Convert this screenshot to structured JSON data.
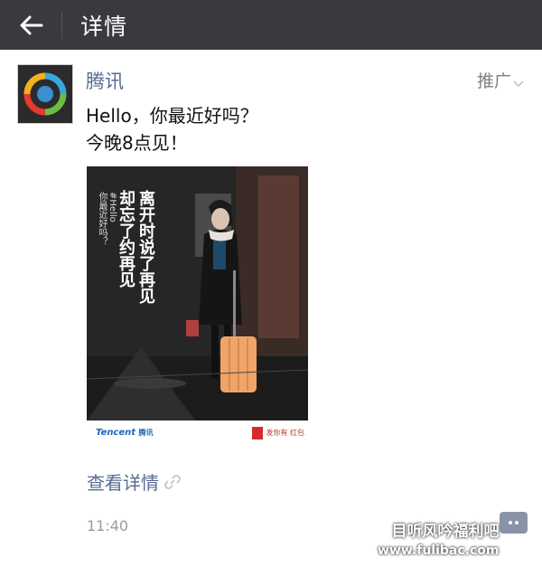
{
  "header": {
    "back_label": "←",
    "title": "详情"
  },
  "post": {
    "author": "腾讯",
    "promo_label": "推广",
    "text_lines": [
      "Hello，你最近好吗？",
      "今晚8点见！"
    ],
    "poster": {
      "calligraphy_lines": [
        "离开时说了再见",
        "却忘了约再见"
      ],
      "side_lines": [
        "#Hello",
        "你最近好吗？"
      ],
      "brand": "Tencent",
      "brand_cn": "腾讯",
      "redpack_text": "发你有 红包"
    },
    "link_label": "查看详情",
    "time": "11:40"
  },
  "watermark": {
    "line1": "目听风吟福利吧",
    "line2": "www.fulibac.com"
  },
  "colors": {
    "topbar": "#393a3f",
    "link": "#576b95",
    "text": "#111111",
    "muted": "#9b9b9b"
  }
}
